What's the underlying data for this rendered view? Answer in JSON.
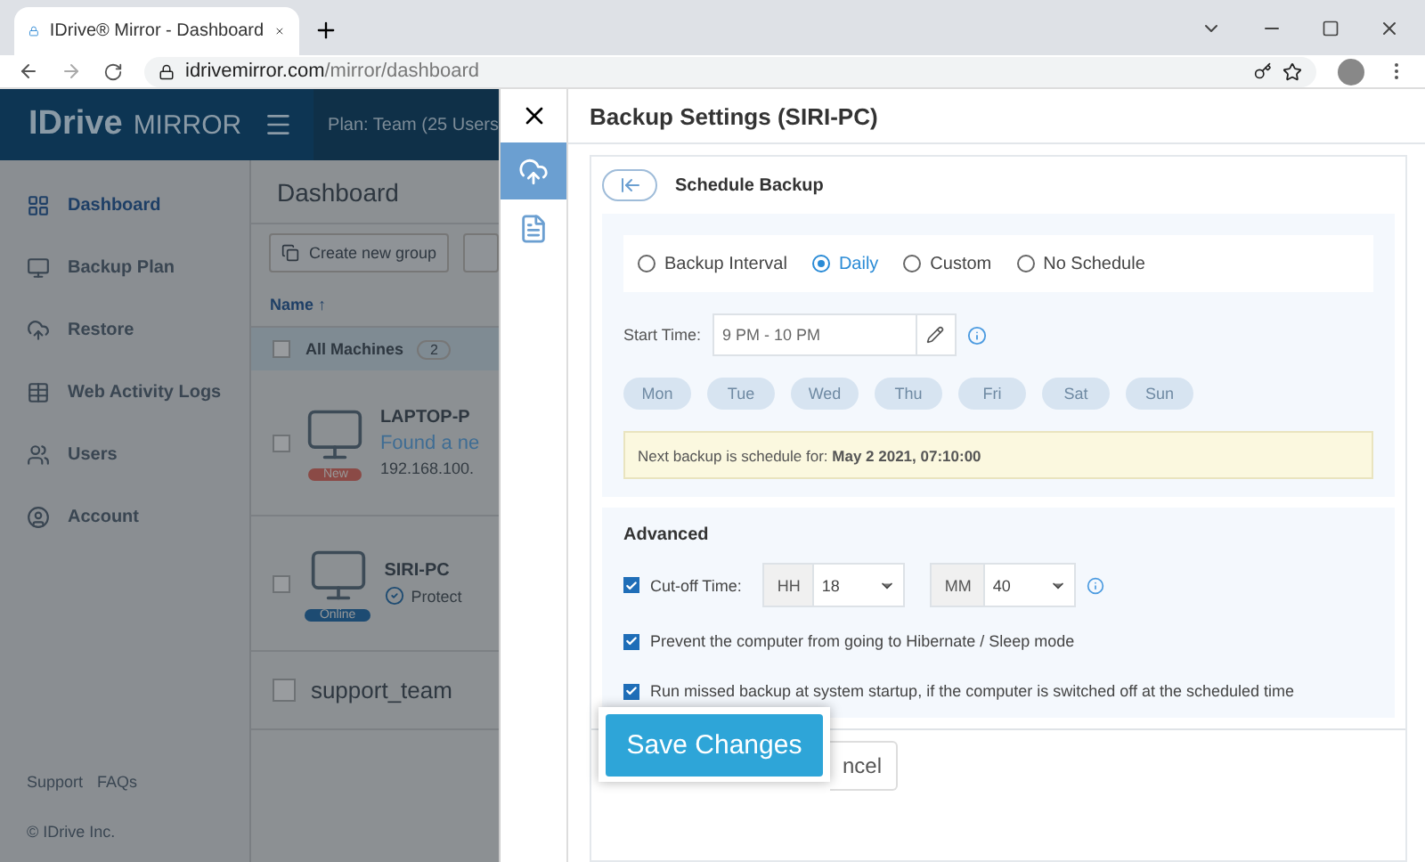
{
  "browser": {
    "tab_title": "IDrive® Mirror - Dashboard",
    "url_host": "idrivemirror.com",
    "url_path": "/mirror/dashboard"
  },
  "header": {
    "logo_main": "IDrive",
    "logo_sub": "MIRROR",
    "plan": "Plan: Team (25 Users"
  },
  "sidebar": {
    "items": [
      {
        "label": "Dashboard",
        "selected": true
      },
      {
        "label": "Backup Plan",
        "selected": false
      },
      {
        "label": "Restore",
        "selected": false
      },
      {
        "label": "Web Activity Logs",
        "selected": false
      },
      {
        "label": "Users",
        "selected": false
      },
      {
        "label": "Account",
        "selected": false
      }
    ],
    "footer_links": [
      "Support",
      "FAQs"
    ],
    "copyright": "© IDrive Inc."
  },
  "main": {
    "title": "Dashboard",
    "create_button": "Create new group",
    "column": "Name ↑",
    "group": {
      "label": "All Machines",
      "count": "2",
      "checked": false
    },
    "machines": [
      {
        "name": "LAPTOP-P",
        "line_1": "Found a ne",
        "line_2": "192.168.100.",
        "badge": "New",
        "kind": "new",
        "checked": false
      },
      {
        "name": "SIRI-PC",
        "line_1": "Protect",
        "badge": "Online",
        "kind": "online",
        "checked": false
      }
    ],
    "team": "support_team",
    "team_checked": false
  },
  "drawer": {
    "title": "Backup Settings (SIRI-PC)",
    "rail": [
      {
        "selected": true
      },
      {
        "selected": false
      }
    ],
    "section": "Schedule Backup",
    "schedule_options": [
      {
        "label": "Backup Interval",
        "selected": false
      },
      {
        "label": "Daily",
        "selected": true
      },
      {
        "label": "Custom",
        "selected": false
      },
      {
        "label": "No Schedule",
        "selected": false
      }
    ],
    "start_time": {
      "label": "Start Time:",
      "value": "9 PM - 10 PM"
    },
    "days": [
      {
        "label": "Mon",
        "selected": false
      },
      {
        "label": "Tue",
        "selected": false
      },
      {
        "label": "Wed",
        "selected": false
      },
      {
        "label": "Thu",
        "selected": false
      },
      {
        "label": "Fri",
        "selected": false
      },
      {
        "label": "Sat",
        "selected": false
      },
      {
        "label": "Sun",
        "selected": false
      }
    ],
    "next_backup": "Next backup is schedule for: **May 2 2021, 07:10:00**",
    "advanced": {
      "title": "Advanced",
      "cutoff": {
        "label": "Cut-off Time:",
        "checked": true,
        "hh_label": "HH",
        "hh": "18",
        "mm_label": "MM",
        "mm": "40"
      },
      "options": [
        {
          "label": "Prevent the computer from going to Hibernate / Sleep mode",
          "checked": true
        },
        {
          "label": "Run missed backup at system startup, if the computer is switched off at the scheduled time",
          "checked": true
        }
      ]
    },
    "save": "Save Changes",
    "cancel": "ncel"
  }
}
